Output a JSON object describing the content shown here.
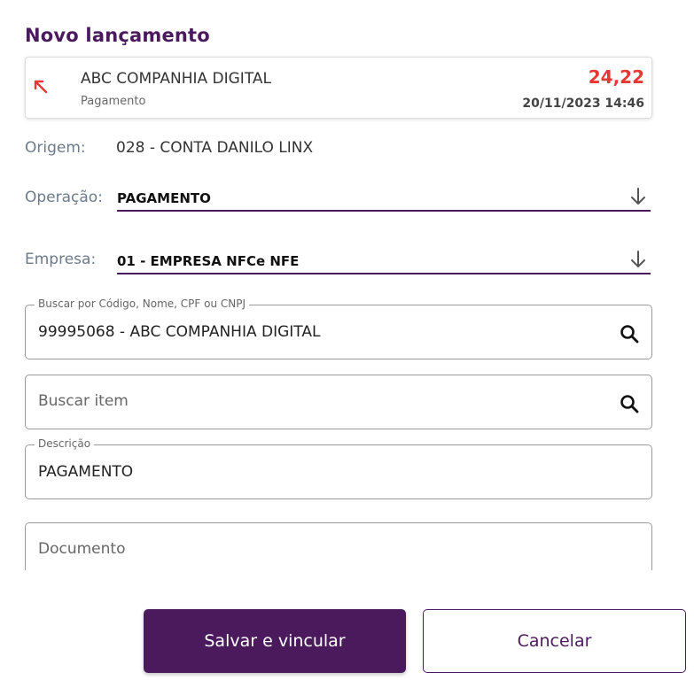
{
  "title": "Novo lançamento",
  "transaction": {
    "icon": "arrow-up-left-icon",
    "name": "ABC COMPANHIA DIGITAL",
    "type": "Pagamento",
    "amount": "24,22",
    "datetime": "20/11/2023 14:46",
    "amount_color": "#e53935"
  },
  "origem": {
    "label": "Origem:",
    "value": "028 - CONTA DANILO LINX"
  },
  "operacao": {
    "label": "Operação:",
    "value": "PAGAMENTO"
  },
  "empresa": {
    "label": "Empresa:",
    "value": "01 - EMPRESA NFCe NFE"
  },
  "buscar_cliente": {
    "legend": "Buscar por Código, Nome, CPF ou CNPJ",
    "value": "99995068 - ABC COMPANHIA DIGITAL"
  },
  "buscar_item": {
    "placeholder": "Buscar item"
  },
  "descricao": {
    "legend": "Descrição",
    "value": "PAGAMENTO"
  },
  "documento": {
    "placeholder": "Documento"
  },
  "buttons": {
    "save": "Salvar e vincular",
    "cancel": "Cancelar"
  },
  "colors": {
    "primary": "#4a1a5c",
    "accent_red": "#e53935",
    "label_gray": "#6c7a8a"
  }
}
